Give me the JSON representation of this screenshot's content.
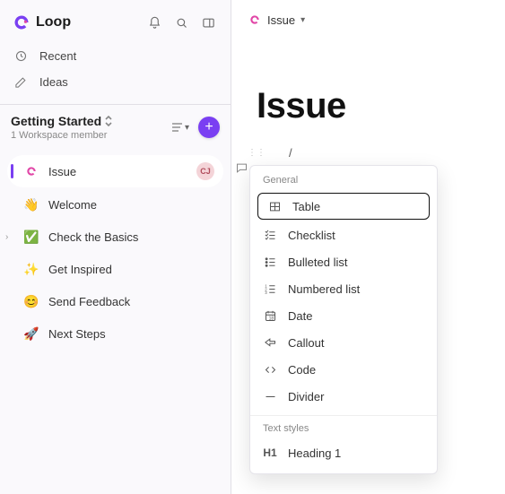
{
  "brand": {
    "name": "Loop"
  },
  "header_icons": {
    "notifications": "notifications",
    "search": "search",
    "panel": "toggle panel"
  },
  "topnav": [
    {
      "id": "recent",
      "label": "Recent"
    },
    {
      "id": "ideas",
      "label": "Ideas"
    }
  ],
  "workspace": {
    "title": "Getting Started",
    "subtitle": "1 Workspace member"
  },
  "pages": [
    {
      "id": "issue",
      "icon": "loop-page",
      "label": "Issue",
      "active": true,
      "avatar": "CJ"
    },
    {
      "id": "welcome",
      "icon": "👋",
      "label": "Welcome"
    },
    {
      "id": "check-basics",
      "icon": "✅",
      "label": "Check the Basics",
      "expandable": true
    },
    {
      "id": "get-inspired",
      "icon": "✨",
      "label": "Get Inspired"
    },
    {
      "id": "feedback",
      "icon": "😊",
      "label": "Send Feedback"
    },
    {
      "id": "next-steps",
      "icon": "🚀",
      "label": "Next Steps"
    }
  ],
  "breadcrumb": {
    "icon": "loop-page",
    "label": "Issue"
  },
  "page": {
    "title": "Issue"
  },
  "slash": {
    "text": "/"
  },
  "insert_menu": {
    "sections": [
      {
        "label": "General",
        "items": [
          {
            "id": "table",
            "label": "Table",
            "icon": "table",
            "current": true
          },
          {
            "id": "checklist",
            "label": "Checklist",
            "icon": "checklist"
          },
          {
            "id": "bulleted",
            "label": "Bulleted list",
            "icon": "bulleted"
          },
          {
            "id": "numbered",
            "label": "Numbered list",
            "icon": "numbered"
          },
          {
            "id": "date",
            "label": "Date",
            "icon": "date"
          },
          {
            "id": "callout",
            "label": "Callout",
            "icon": "callout"
          },
          {
            "id": "code",
            "label": "Code",
            "icon": "code"
          },
          {
            "id": "divider",
            "label": "Divider",
            "icon": "divider"
          }
        ]
      },
      {
        "label": "Text styles",
        "items": [
          {
            "id": "h1",
            "label": "Heading 1",
            "icon": "h1"
          }
        ]
      }
    ]
  }
}
